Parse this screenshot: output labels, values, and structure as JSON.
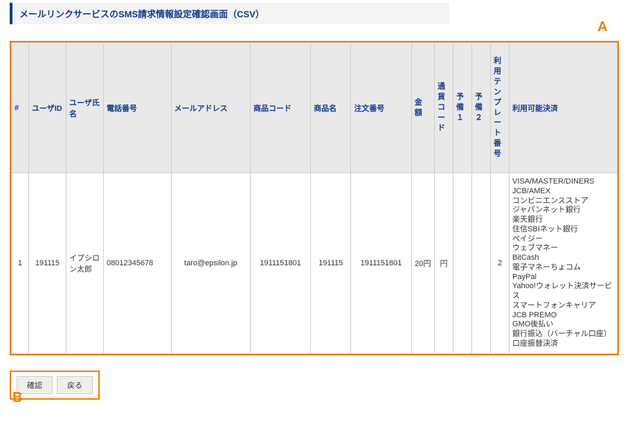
{
  "page_title": "メールリンクサービスのSMS請求情報設定確認画面（CSV）",
  "markers": {
    "a": "A",
    "b": "B"
  },
  "columns": {
    "idx": "#",
    "user_id": "ユーザID",
    "user_name": "ユーザ氏名",
    "phone": "電話番号",
    "email": "メールアドレス",
    "product_code": "商品コード",
    "product_name": "商品名",
    "order_no": "注文番号",
    "amount": "金額",
    "currency": "通貨コード",
    "reserve1": "予備１",
    "reserve2": "予備２",
    "template_no": "利用テンプレート番号",
    "payments": "利用可能決済"
  },
  "rows": [
    {
      "idx": "1",
      "user_id": "191115",
      "user_name": "イプシロン太郎",
      "phone": "08012345678",
      "email": "taro@epsilon.jp",
      "product_code": "1911151801",
      "product_name": "191115",
      "order_no": "1911151801",
      "amount": "20円",
      "currency": "円",
      "reserve1": "",
      "reserve2": "",
      "template_no": "2",
      "payments": "VISA/MASTER/DINERS\nJCB/AMEX\nコンビニエンスストア\nジャパンネット銀行\n楽天銀行\n住信SBIネット銀行\nペイジー\nウェブマネー\nBitCash\n電子マネーちょコム\nPayPal\nYahoo!ウォレット決済サービス\nスマートフォンキャリア\nJCB PREMO\nGMO後払い\n銀行振込（バーチャル口座）\n口座振替決済"
    }
  ],
  "buttons": {
    "confirm": "確認",
    "back": "戻る"
  }
}
